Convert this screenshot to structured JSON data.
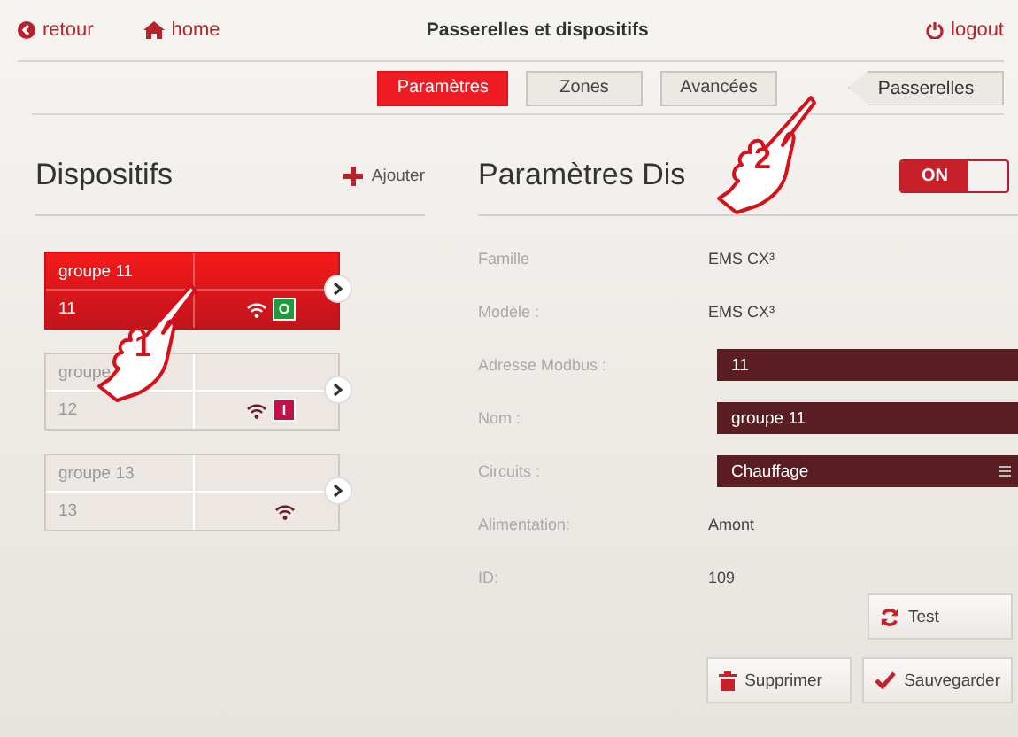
{
  "header": {
    "back": "retour",
    "home": "home",
    "title": "Passerelles et dispositifs",
    "logout": "logout"
  },
  "tabs": [
    {
      "label": "Paramètres",
      "selected": true
    },
    {
      "label": "Zones",
      "selected": false
    },
    {
      "label": "Avancées",
      "selected": false
    }
  ],
  "gateways_button": "Passerelles",
  "devices": {
    "title": "Dispositifs",
    "add": "Ajouter",
    "items": [
      {
        "name": "groupe 11",
        "address": "11",
        "selected": true,
        "status": {
          "text": "O",
          "color": "#1f9b3c"
        }
      },
      {
        "name": "groupe",
        "address": "12",
        "selected": false,
        "status": {
          "text": "I",
          "color": "#c0124a"
        }
      },
      {
        "name": "groupe 13",
        "address": "13",
        "selected": false
      }
    ]
  },
  "settings": {
    "title": "Paramètres Dis",
    "switch": {
      "label": "ON",
      "on": true
    },
    "rows": [
      {
        "kind": "text",
        "label": "Famille",
        "value": "EMS CX³"
      },
      {
        "kind": "text",
        "label": "Modèle :",
        "value": "EMS CX³"
      },
      {
        "kind": "field",
        "label": "Adresse Modbus :",
        "value": "11"
      },
      {
        "kind": "field",
        "label": "Nom :",
        "value": "groupe 11"
      },
      {
        "kind": "select",
        "label": "Circuits :",
        "value": "Chauffage"
      },
      {
        "kind": "text",
        "label": "Alimentation:",
        "value": "Amont"
      },
      {
        "kind": "text",
        "label": "ID:",
        "value": "109"
      }
    ],
    "test": "Test",
    "delete": "Supprimer",
    "save": "Sauvegarder"
  },
  "callouts": [
    "1",
    "2"
  ]
}
